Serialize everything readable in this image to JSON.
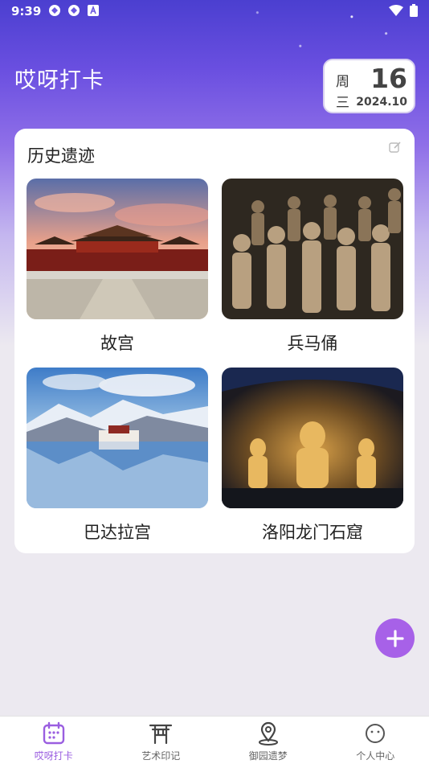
{
  "status": {
    "time": "9:39"
  },
  "header": {
    "title": "哎呀打卡",
    "date": {
      "week_line1": "周",
      "week_line2": "三",
      "day": "16",
      "year_month": "2024.10"
    }
  },
  "card": {
    "title": "历史遗迹",
    "sites": [
      {
        "name": "故宫"
      },
      {
        "name": "兵马俑"
      },
      {
        "name": "巴达拉宫"
      },
      {
        "name": "洛阳龙门石窟"
      }
    ]
  },
  "tabs": [
    {
      "label": "哎呀打卡",
      "icon": "calendar-icon",
      "active": true
    },
    {
      "label": "艺术印记",
      "icon": "torii-gate-icon",
      "active": false
    },
    {
      "label": "御园遗梦",
      "icon": "map-pin-icon",
      "active": false
    },
    {
      "label": "个人中心",
      "icon": "smile-face-icon",
      "active": false
    }
  ],
  "colors": {
    "accent": "#9a5ee0",
    "fab": "#a761e8",
    "header_gradient_top": "#4b3fd0"
  }
}
